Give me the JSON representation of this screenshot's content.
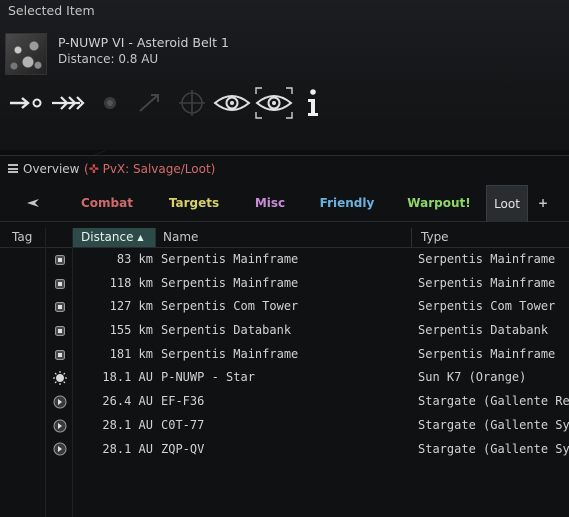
{
  "selected_item": {
    "title": "Selected Item",
    "name": "P-NUWP VI - Asteroid Belt 1",
    "distance": "Distance: 0.8 AU",
    "actions": [
      {
        "icon": "approach-icon",
        "enabled": true
      },
      {
        "icon": "warp-to-icon",
        "enabled": true
      },
      {
        "icon": "orbit-icon",
        "enabled": false
      },
      {
        "icon": "jump-icon",
        "enabled": false
      },
      {
        "icon": "lock-target-icon",
        "enabled": false
      },
      {
        "icon": "look-at-icon",
        "enabled": true
      },
      {
        "icon": "look-at-selected-icon",
        "enabled": true
      },
      {
        "icon": "show-info-icon",
        "enabled": true
      }
    ]
  },
  "overview": {
    "title": "Overview",
    "preset": "PvX: Salvage/Loot",
    "tabs": [
      {
        "label": "",
        "icon": "ship-icon",
        "color": "#c8c8c8"
      },
      {
        "label": "Combat",
        "color": "#d06a6a"
      },
      {
        "label": "Targets",
        "color": "#d7d16a"
      },
      {
        "label": "Misc",
        "color": "#c78bd6"
      },
      {
        "label": "Friendly",
        "color": "#6ab2e0"
      },
      {
        "label": "Warpout!",
        "color": "#8fd76a"
      },
      {
        "label": "Loot",
        "color": "#e6e6e6",
        "active": true
      },
      {
        "label": "+",
        "color": "#c8c8c8"
      }
    ],
    "columns": {
      "tag": "Tag",
      "distance": "Distance",
      "name": "Name",
      "type": "Type"
    },
    "rows": [
      {
        "icon": "wreck-icon",
        "distance": "83 km",
        "name": "Serpentis Mainframe",
        "type": "Serpentis Mainframe"
      },
      {
        "icon": "wreck-icon",
        "distance": "118 km",
        "name": "Serpentis Mainframe",
        "type": "Serpentis Mainframe"
      },
      {
        "icon": "wreck-icon",
        "distance": "127 km",
        "name": "Serpentis Com Tower",
        "type": "Serpentis Com Tower"
      },
      {
        "icon": "wreck-icon",
        "distance": "155 km",
        "name": "Serpentis Databank",
        "type": "Serpentis Databank"
      },
      {
        "icon": "wreck-icon",
        "distance": "181 km",
        "name": "Serpentis Mainframe",
        "type": "Serpentis Mainframe"
      },
      {
        "icon": "sun-icon",
        "distance": "18.1 AU",
        "name": "P-NUWP - Star",
        "type": "Sun K7 (Orange)"
      },
      {
        "icon": "stargate-icon",
        "distance": "26.4 AU",
        "name": "EF-F36",
        "type": "Stargate (Gallente Regi"
      },
      {
        "icon": "stargate-icon",
        "distance": "28.1 AU",
        "name": "C0T-77",
        "type": "Stargate (Gallente Syst"
      },
      {
        "icon": "stargate-icon",
        "distance": "28.1 AU",
        "name": "ZQP-QV",
        "type": "Stargate (Gallente Syst"
      }
    ]
  }
}
